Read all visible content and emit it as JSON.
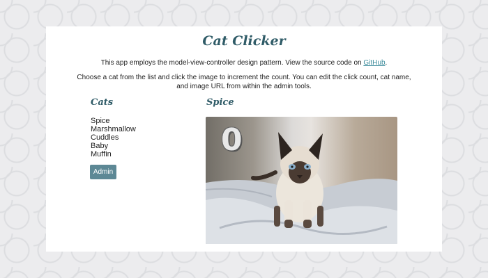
{
  "app": {
    "title": "Cat Clicker"
  },
  "intro": {
    "line1_text": "This app employs the model-view-controller design pattern. View the source code on ",
    "source_link": "GitHub",
    "line1_end": ".",
    "line2_text": "Choose a cat from the list and click the image to increment the count. You can edit the click count, cat name, and image URL from within the admin tools."
  },
  "sidebar": {
    "heading": "Cats",
    "cats": [
      {
        "name": "Spice"
      },
      {
        "name": "Marshmallow"
      },
      {
        "name": "Cuddles"
      },
      {
        "name": "Baby"
      },
      {
        "name": "Muffin"
      }
    ],
    "admin_label": "Admin"
  },
  "selected_cat": {
    "name": "Spice",
    "click_count": "0",
    "image_icon": "siamese-kitten-photo"
  },
  "colors": {
    "accent": "#2f5b67",
    "button": "#5d8895",
    "link": "#3a8a9a"
  }
}
